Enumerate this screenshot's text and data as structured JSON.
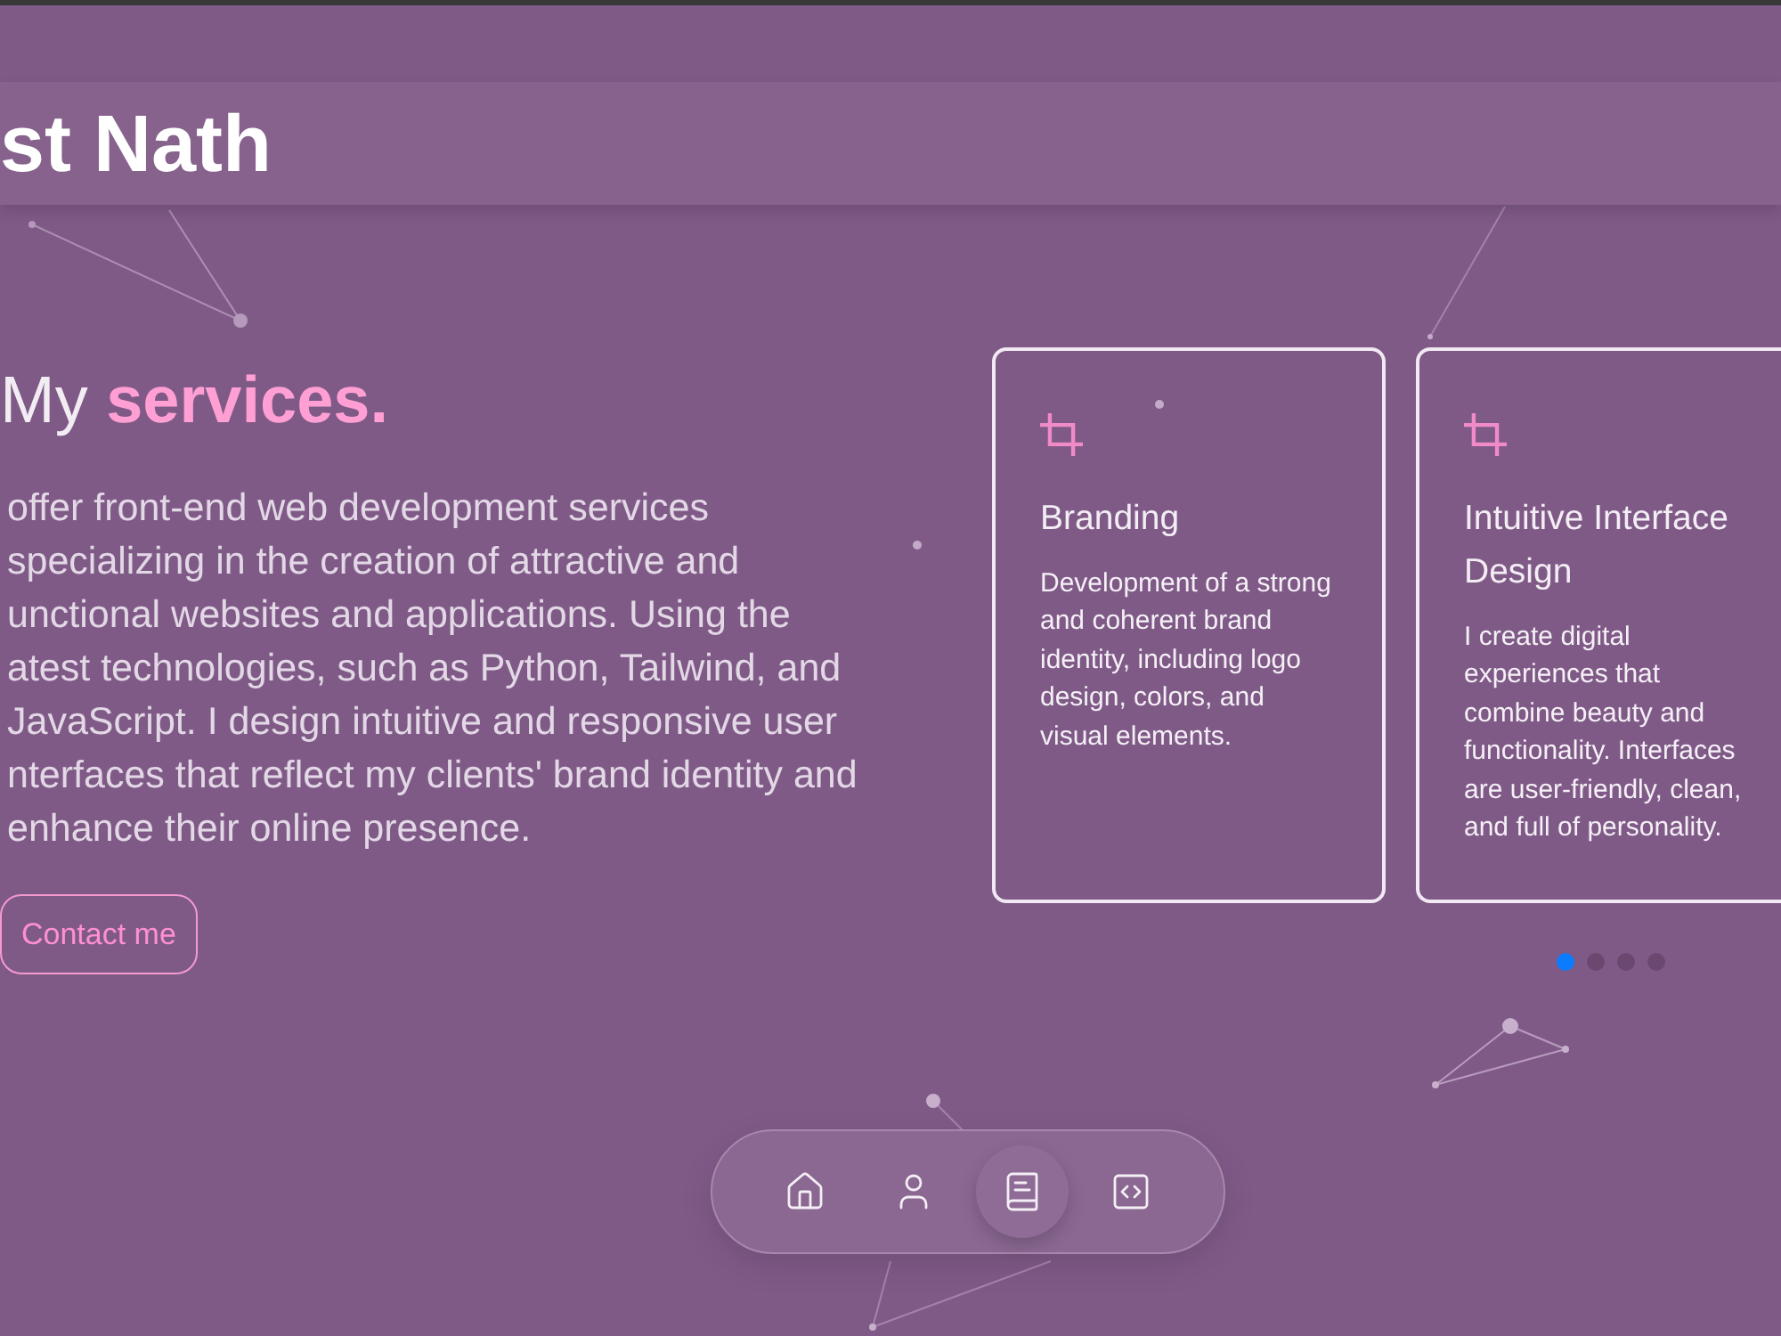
{
  "header": {
    "title": "st Nath"
  },
  "hero": {
    "heading": "My **services.**",
    "paragraph": "offer front-end web development services\nspecializing in the creation of attractive and\nunctional websites and applications. Using the\natest technologies, such as Python, Tailwind, and\nJavaScript. I design intuitive and responsive user\nnterfaces that reflect my clients' brand identity and\nenhance their online presence.",
    "button": "Contact me"
  },
  "services": [
    {
      "title": "Branding",
      "description": "Development of a strong and coherent brand identity, including logo design, colors, and visual elements."
    },
    {
      "title": "Intuitive Interface Design",
      "description": "I create digital experiences that combine beauty and functionality. Interfaces are user-friendly, clean, and full of personality."
    }
  ],
  "carousel": {
    "dots": [
      {
        "selected": true
      },
      {
        "selected": false
      },
      {
        "selected": false
      },
      {
        "selected": false
      }
    ]
  },
  "nav": {
    "items": [
      {
        "selected": false
      },
      {
        "selected": false
      },
      {
        "selected": true
      },
      {
        "selected": false
      }
    ]
  }
}
